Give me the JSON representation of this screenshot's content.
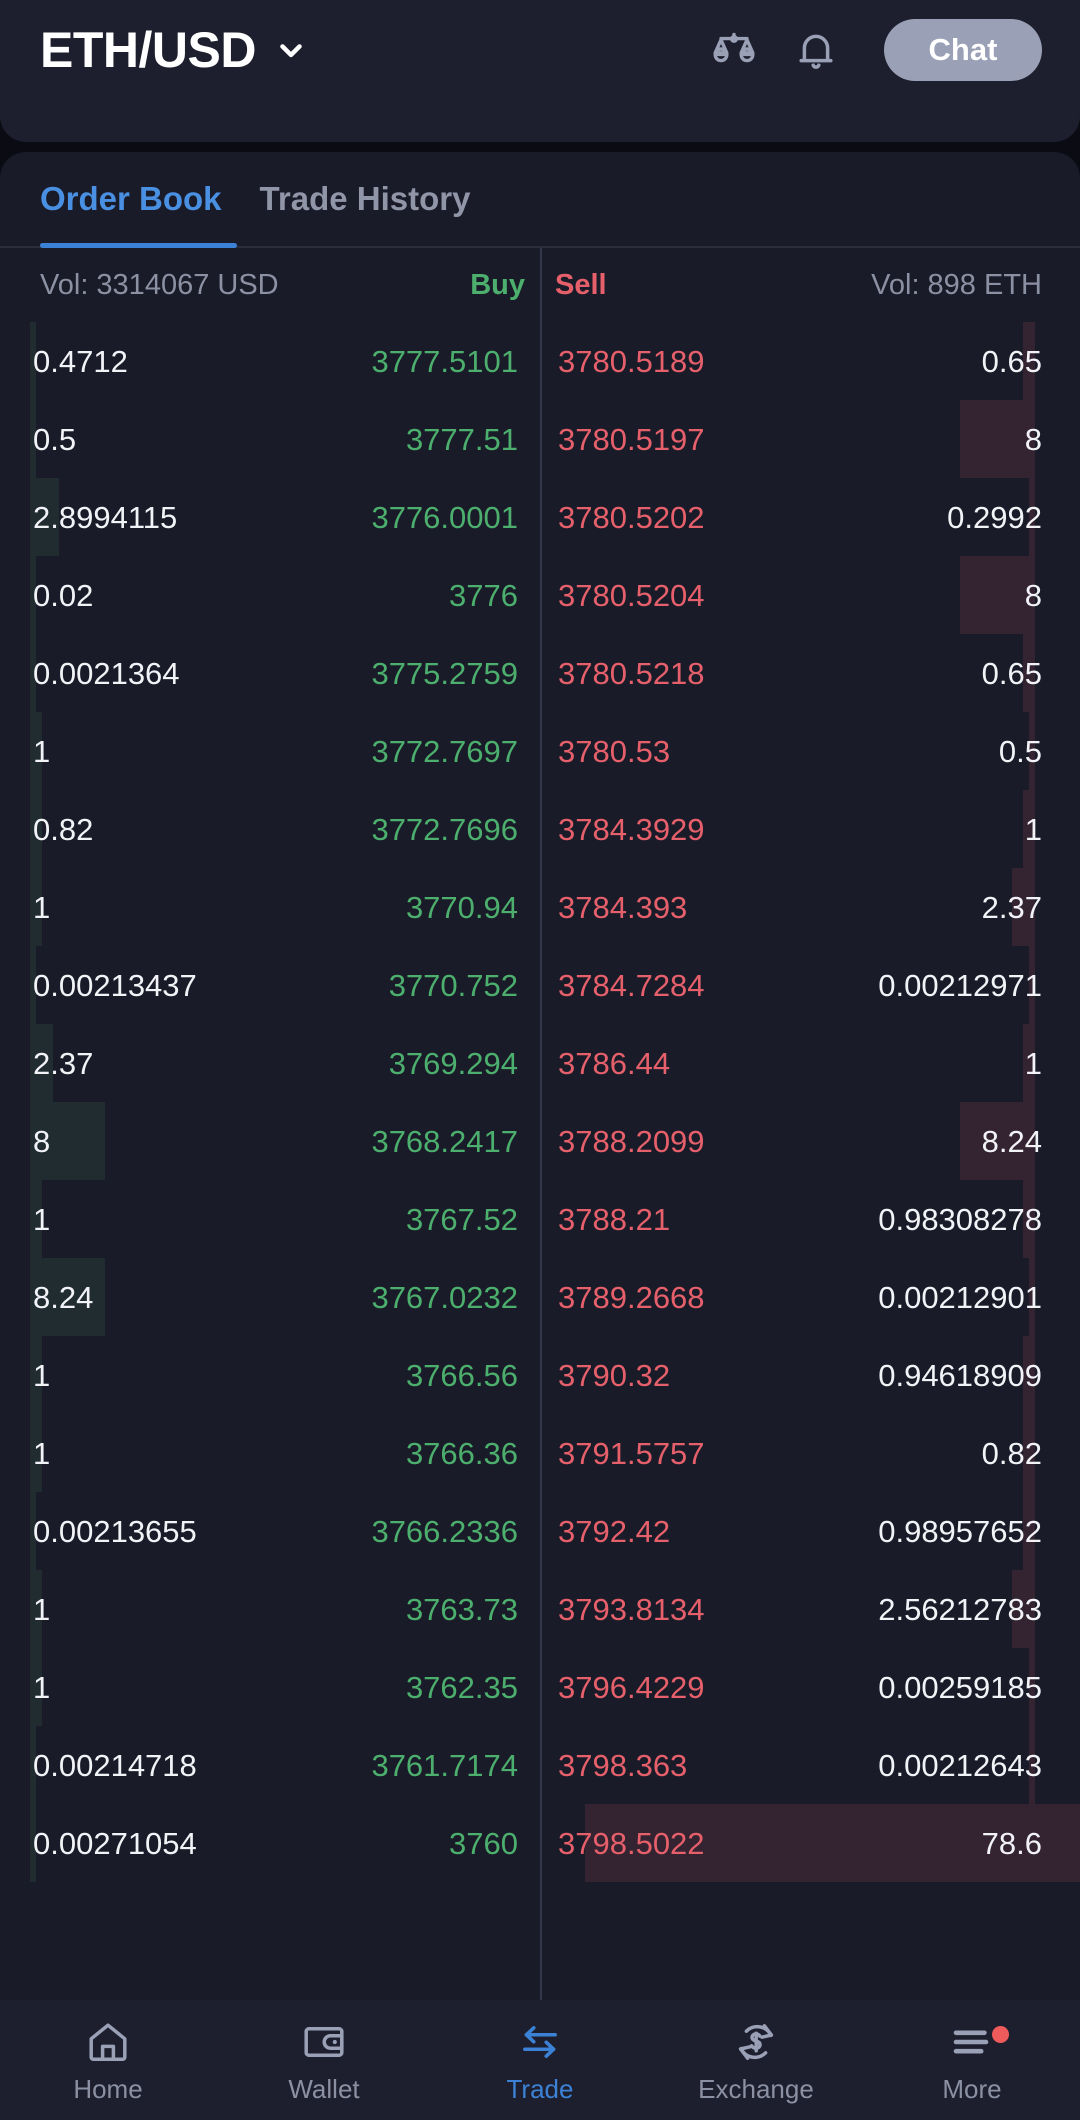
{
  "header": {
    "pair": "ETH/USD",
    "chevron_icon": "chevron-down-icon",
    "scales_icon": "scales-icon",
    "bell_icon": "bell-icon",
    "chat_label": "Chat"
  },
  "tabs": [
    {
      "label": "Order Book",
      "active": true
    },
    {
      "label": "Trade History",
      "active": false
    }
  ],
  "orderbook": {
    "vol_left": "Vol: 3314067 USD",
    "buy_label": "Buy",
    "sell_label": "Sell",
    "vol_right": "Vol: 898 ETH",
    "colors": {
      "buy": "#4caf6d",
      "sell": "#e5606b",
      "accent": "#3b82d6",
      "card": "#1a1b28",
      "header_card": "#1e1f2e",
      "page": "#0b0b14"
    },
    "bids": [
      {
        "amount": "0.4712",
        "price": "3777.5101",
        "depth": 1
      },
      {
        "amount": "0.5",
        "price": "3777.51",
        "depth": 1
      },
      {
        "amount": "2.8994115",
        "price": "3776.0001",
        "depth": 5
      },
      {
        "amount": "0.02",
        "price": "3776",
        "depth": 1
      },
      {
        "amount": "0.0021364",
        "price": "3775.2759",
        "depth": 1
      },
      {
        "amount": "1",
        "price": "3772.7697",
        "depth": 2
      },
      {
        "amount": "0.82",
        "price": "3772.7696",
        "depth": 2
      },
      {
        "amount": "1",
        "price": "3770.94",
        "depth": 2
      },
      {
        "amount": "0.00213437",
        "price": "3770.752",
        "depth": 1
      },
      {
        "amount": "2.37",
        "price": "3769.294",
        "depth": 4
      },
      {
        "amount": "8",
        "price": "3768.2417",
        "depth": 13
      },
      {
        "amount": "1",
        "price": "3767.52",
        "depth": 2
      },
      {
        "amount": "8.24",
        "price": "3767.0232",
        "depth": 13
      },
      {
        "amount": "1",
        "price": "3766.56",
        "depth": 2
      },
      {
        "amount": "1",
        "price": "3766.36",
        "depth": 2
      },
      {
        "amount": "0.00213655",
        "price": "3766.2336",
        "depth": 1
      },
      {
        "amount": "1",
        "price": "3763.73",
        "depth": 2
      },
      {
        "amount": "1",
        "price": "3762.35",
        "depth": 2
      },
      {
        "amount": "0.00214718",
        "price": "3761.7174",
        "depth": 1
      },
      {
        "amount": "0.00271054",
        "price": "3760",
        "depth": 1
      }
    ],
    "asks": [
      {
        "price": "3780.5189",
        "amount": "0.65",
        "depth": 2
      },
      {
        "price": "3780.5197",
        "amount": "8",
        "depth": 13
      },
      {
        "price": "3780.5202",
        "amount": "0.2992",
        "depth": 1
      },
      {
        "price": "3780.5204",
        "amount": "8",
        "depth": 13
      },
      {
        "price": "3780.5218",
        "amount": "0.65",
        "depth": 2
      },
      {
        "price": "3780.53",
        "amount": "0.5",
        "depth": 1
      },
      {
        "price": "3784.3929",
        "amount": "1",
        "depth": 2
      },
      {
        "price": "3784.393",
        "amount": "2.37",
        "depth": 4
      },
      {
        "price": "3784.7284",
        "amount": "0.00212971",
        "depth": 1
      },
      {
        "price": "3786.44",
        "amount": "1",
        "depth": 2
      },
      {
        "price": "3788.2099",
        "amount": "8.24",
        "depth": 13
      },
      {
        "price": "3788.21",
        "amount": "0.98308278",
        "depth": 2
      },
      {
        "price": "3789.2668",
        "amount": "0.00212901",
        "depth": 1
      },
      {
        "price": "3790.32",
        "amount": "0.94618909",
        "depth": 2
      },
      {
        "price": "3791.5757",
        "amount": "0.82",
        "depth": 2
      },
      {
        "price": "3792.42",
        "amount": "0.98957652",
        "depth": 2
      },
      {
        "price": "3793.8134",
        "amount": "2.56212783",
        "depth": 4
      },
      {
        "price": "3796.4229",
        "amount": "0.00259185",
        "depth": 1
      },
      {
        "price": "3798.363",
        "amount": "0.00212643",
        "depth": 1
      },
      {
        "price": "3798.5022",
        "amount": "78.6",
        "depth": 100
      }
    ]
  },
  "bottom_nav": [
    {
      "label": "Home",
      "icon": "home-icon",
      "active": false,
      "badge": false
    },
    {
      "label": "Wallet",
      "icon": "wallet-icon",
      "active": false,
      "badge": false
    },
    {
      "label": "Trade",
      "icon": "trade-icon",
      "active": true,
      "badge": false
    },
    {
      "label": "Exchange",
      "icon": "exchange-icon",
      "active": false,
      "badge": false
    },
    {
      "label": "More",
      "icon": "menu-icon",
      "active": false,
      "badge": true
    }
  ]
}
